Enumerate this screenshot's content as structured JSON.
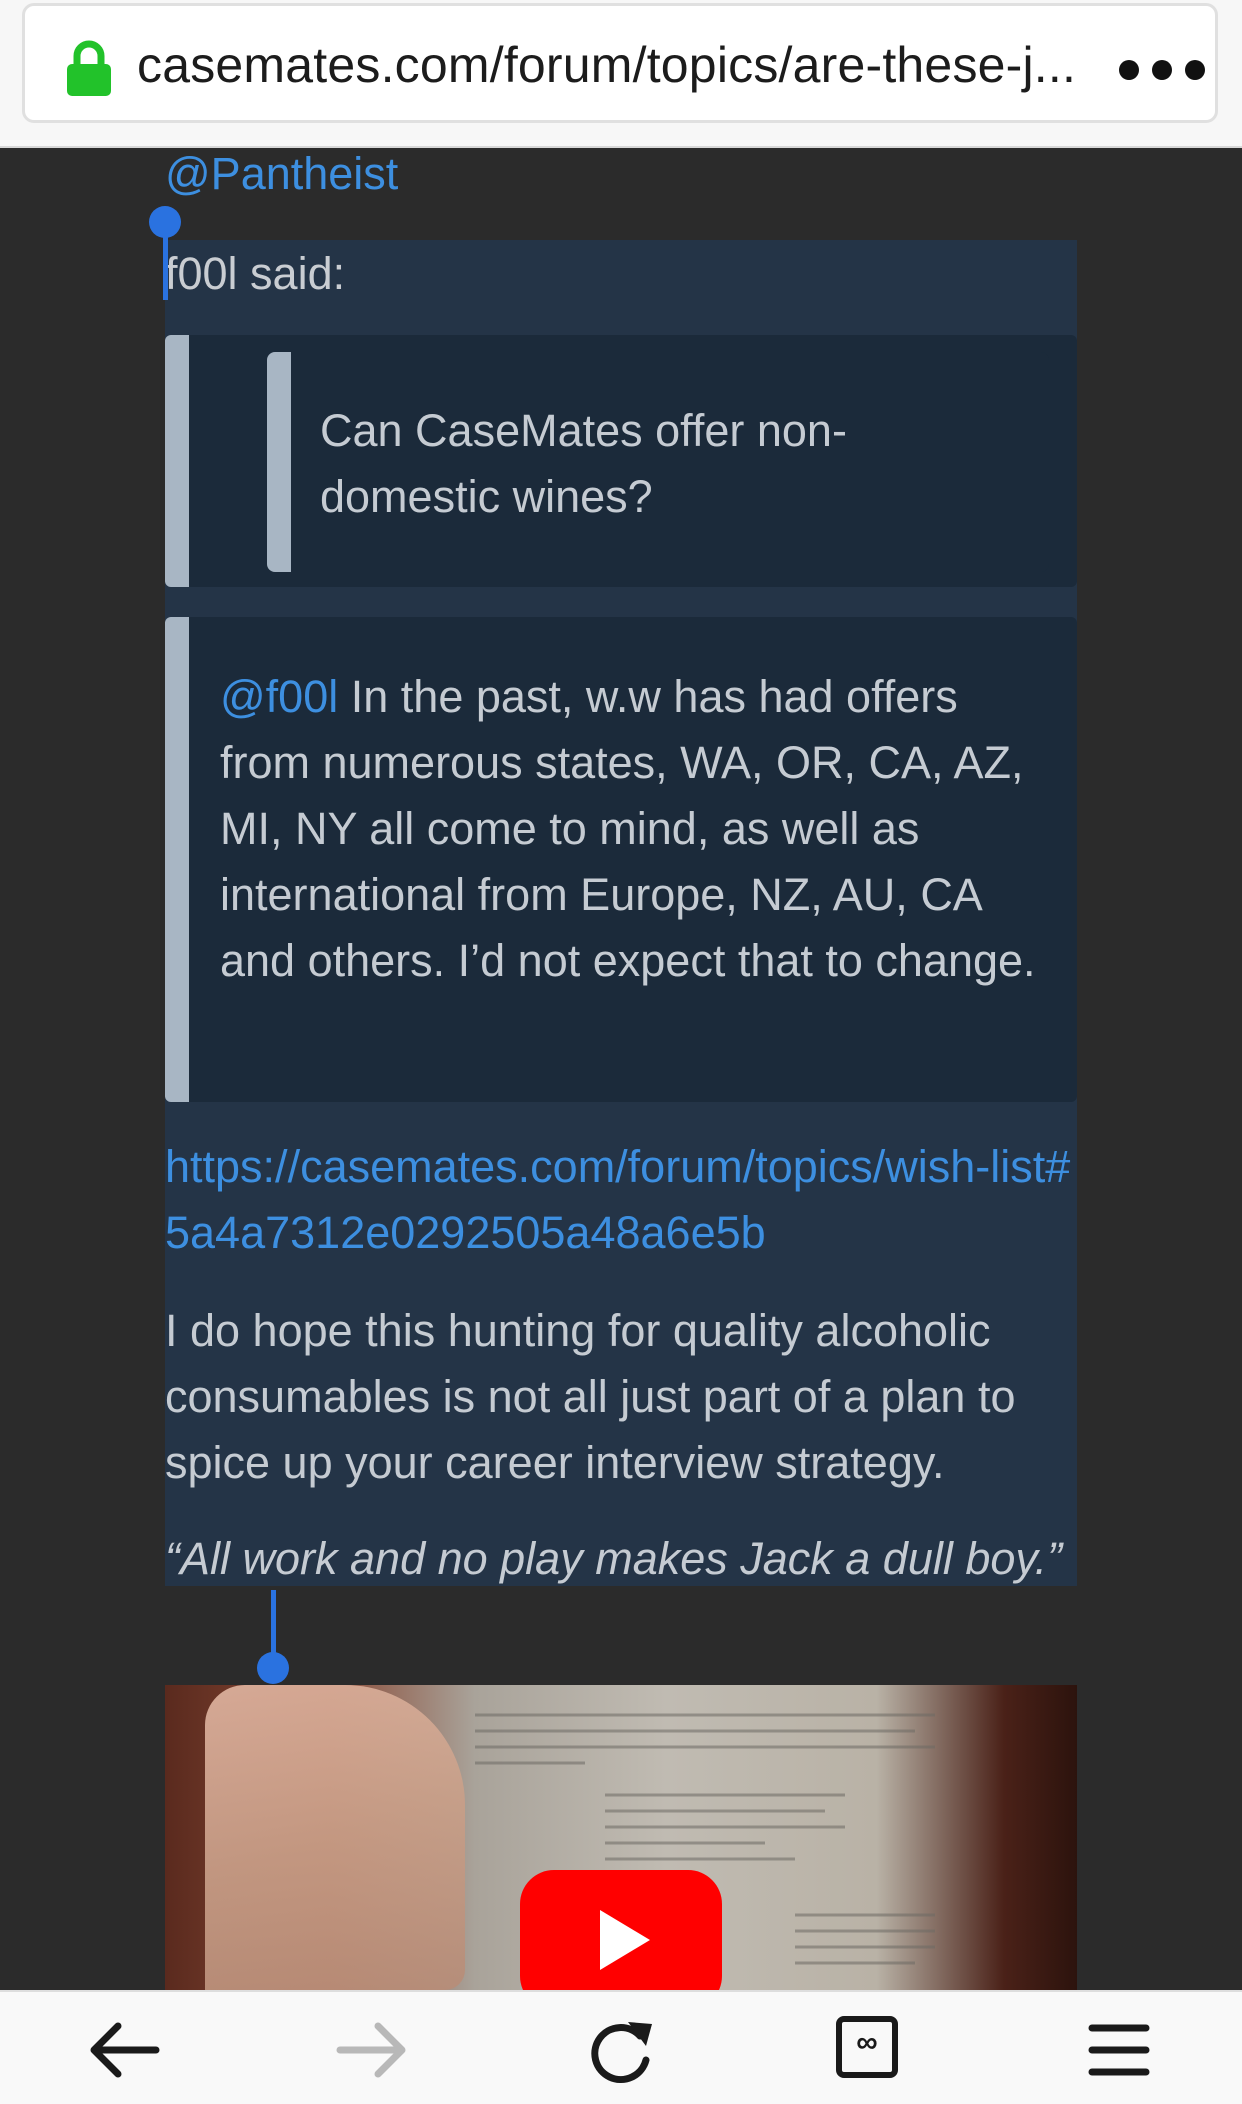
{
  "browser": {
    "url": "casemates.com/forum/topics/are-these-j...",
    "icons": {
      "lock": "lock-icon",
      "menu": "more-dots-icon"
    }
  },
  "post": {
    "mention_top": "@Pantheist",
    "quote_author_line": "f00l said:",
    "inner_quote": "Can CaseMates offer non-domestic wines?",
    "reply_mention": "@f00l",
    "reply_text": " In the past, w.w has had offers from numerous states, WA, OR, CA, AZ, MI, NY all come to mind, as well as international from Europe, NZ, AU, CA and others. I’d not expect that to change.",
    "link": "https://casemates.com/forum/topics/wish-list#5a4a7312e0292505a48a6e5b",
    "paragraph": "I do hope this hunting for quality alcoholic consumables is not all just part of a plan to spice up your career interview strategy.",
    "italic_quote": "“All work and no play makes Jack a dull boy.”"
  },
  "video": {
    "play_icon": "youtube-play-icon"
  },
  "toolbar": {
    "icons": [
      "back-arrow-icon",
      "forward-arrow-icon",
      "reload-icon",
      "tabs-icon",
      "menu-icon"
    ],
    "tabs_symbol": "∞"
  },
  "colors": {
    "link": "#3d8fe0",
    "quote_bar": "#a8b6c4",
    "post_bg": "#243447",
    "selection": "#2a72e0",
    "lock": "#22c22a",
    "youtube": "#ff0000"
  }
}
